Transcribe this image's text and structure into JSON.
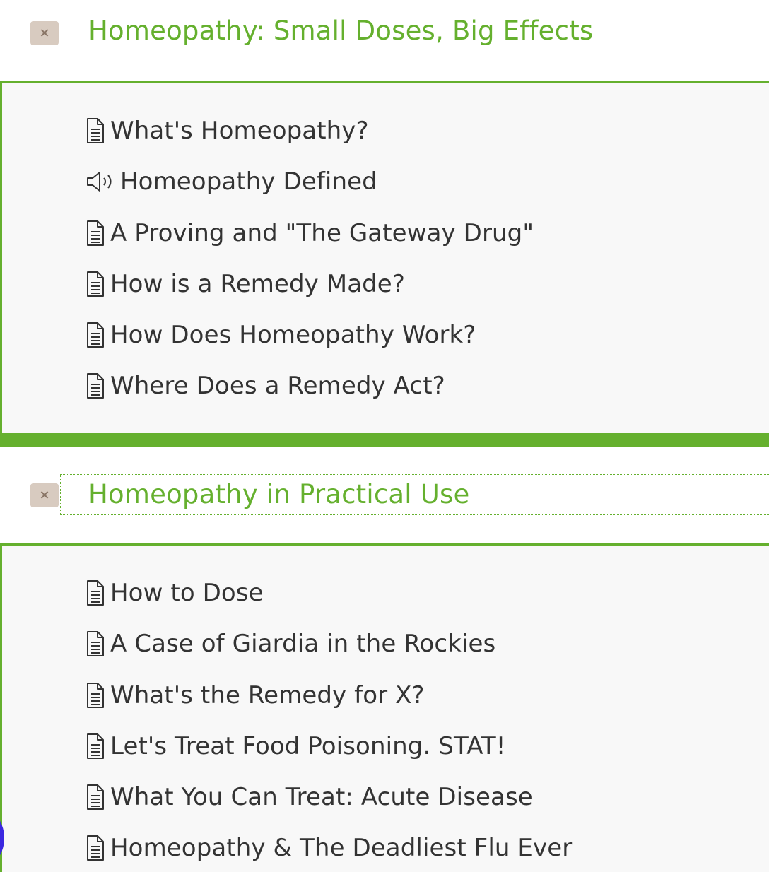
{
  "colors": {
    "accent_green": "#65b02e",
    "text_dark": "#333333",
    "close_button_bg": "#d8cbc0",
    "close_button_fg": "#8a7667",
    "panel_bg": "#f8f8f8",
    "blob": "#3b28e0"
  },
  "sections": [
    {
      "title": "Homeopathy: Small Doses, Big Effects",
      "toggle_glyph": "×",
      "lessons": [
        {
          "icon": "document-icon",
          "label": "What's Homeopathy?"
        },
        {
          "icon": "speaker-icon",
          "label": "Homeopathy Defined"
        },
        {
          "icon": "document-icon",
          "label": "A Proving and \"The Gateway Drug\""
        },
        {
          "icon": "document-icon",
          "label": "How is a Remedy Made?"
        },
        {
          "icon": "document-icon",
          "label": "How Does Homeopathy Work?"
        },
        {
          "icon": "document-icon",
          "label": "Where Does a Remedy Act?"
        }
      ]
    },
    {
      "title": "Homeopathy in Practical Use",
      "toggle_glyph": "×",
      "lessons": [
        {
          "icon": "document-icon",
          "label": "How to Dose"
        },
        {
          "icon": "document-icon",
          "label": "A Case of Giardia in the Rockies"
        },
        {
          "icon": "document-icon",
          "label": "What's the Remedy for X?"
        },
        {
          "icon": "document-icon",
          "label": "Let's Treat Food Poisoning. STAT!"
        },
        {
          "icon": "document-icon",
          "label": "What You Can Treat: Acute Disease"
        },
        {
          "icon": "document-icon",
          "label": "Homeopathy & The Deadliest Flu Ever"
        }
      ]
    }
  ]
}
